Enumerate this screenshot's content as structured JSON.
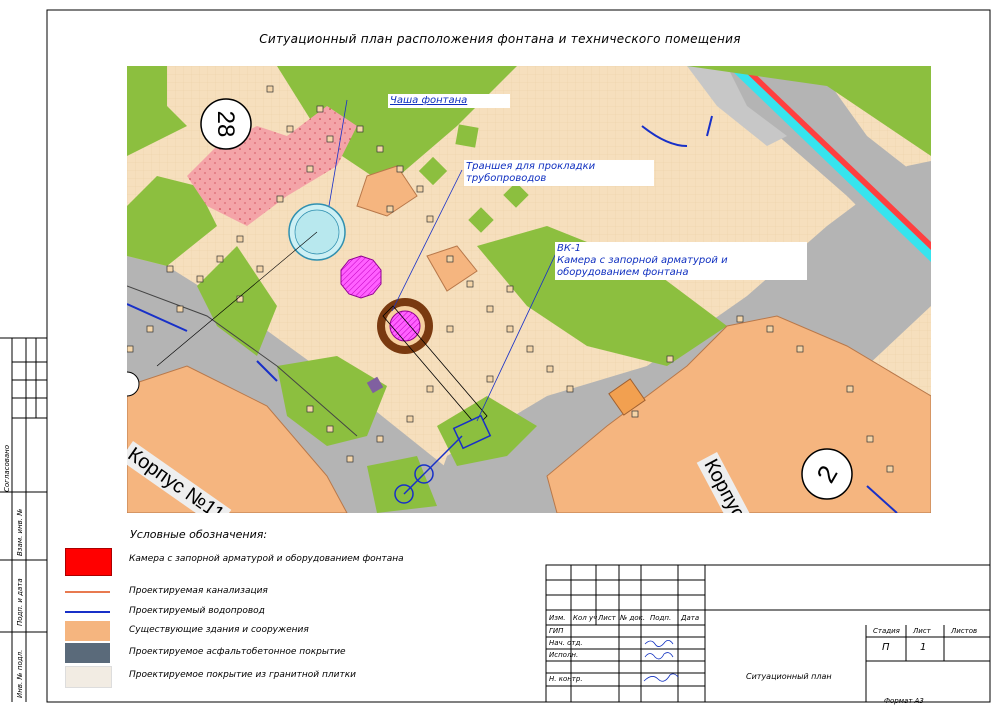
{
  "title": "Ситуационный план расположения фонтана и технического помещения",
  "map": {
    "building_labels": [
      "Корпус №11",
      "Корпус"
    ],
    "building_numbers": [
      "28",
      "2"
    ],
    "callouts": {
      "bowl": "Чаша фонтана",
      "trench_line1": "Траншея для прокладки",
      "trench_line2": "трубопроводов",
      "chamber_line1": "ВК-1",
      "chamber_line2": "Камера с запорной арматурой и",
      "chamber_line3": "оборудованием фонтана"
    }
  },
  "legend": {
    "title": "Условные обозначения:",
    "items": [
      {
        "label": "Камера с запорной арматурой и оборудованием фонтана",
        "color": "#ff0000"
      },
      {
        "label": "Проектируемая канализация",
        "color": "#e87a50"
      },
      {
        "label": "Проектируемый водопровод",
        "color": "#1830c8"
      },
      {
        "label": "Существующие здания и сооружения",
        "color": "#f5b57f"
      },
      {
        "label": "Проектируемое асфальтобетонное покрытие",
        "color": "#5a6a7a"
      },
      {
        "label": "Проектируемое покрытие из гранитной плитки",
        "color": "#f2ece3"
      }
    ]
  },
  "stamp": {
    "columns": [
      "Изм.",
      "Кол уч",
      "Лист",
      "№ док.",
      "Подп.",
      "Дата"
    ],
    "roles": [
      "ГИП",
      "Нач. отд.",
      "Исполн.",
      "",
      "Н. контр."
    ],
    "stage_header": "Стадия",
    "sheet_header": "Лист",
    "sheets_header": "Листов",
    "stage_value": "П",
    "sheet_value": "1",
    "sheet_title": "Ситуационный план",
    "format": "Формат   А3"
  },
  "side_stamp": {
    "agreed": "Согласовано",
    "inv_replace": "Взам. инв. №",
    "sign_date": "Подп. и дата",
    "inv_original": "Инв. № подл."
  }
}
